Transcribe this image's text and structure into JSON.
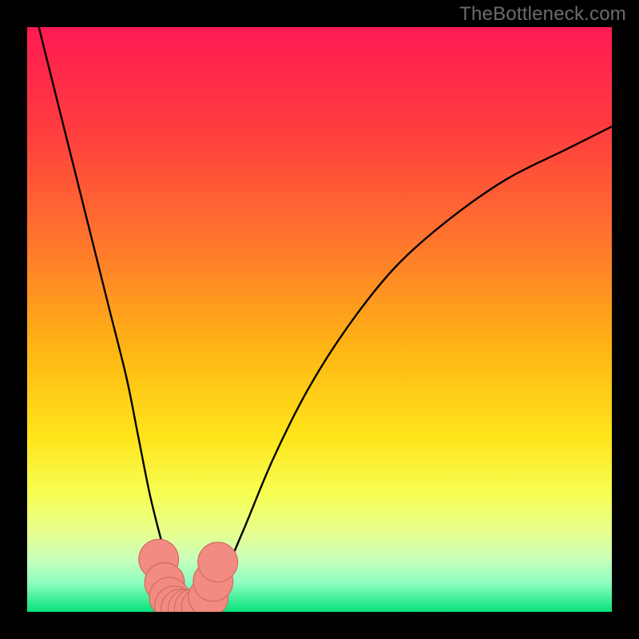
{
  "watermark": "TheBottleneck.com",
  "chart_data": {
    "type": "line",
    "title": "",
    "xlabel": "",
    "ylabel": "",
    "xlim": [
      0,
      100
    ],
    "ylim": [
      0,
      100
    ],
    "grid": false,
    "legend": false,
    "annotations": [],
    "background": {
      "type": "vertical-gradient",
      "stops": [
        {
          "pct": 0,
          "color": "#ff1a53"
        },
        {
          "pct": 18,
          "color": "#ff3e3e"
        },
        {
          "pct": 38,
          "color": "#ff7a2b"
        },
        {
          "pct": 55,
          "color": "#ffb514"
        },
        {
          "pct": 70,
          "color": "#ffe41b"
        },
        {
          "pct": 80,
          "color": "#f6ff54"
        },
        {
          "pct": 86,
          "color": "#eaff8c"
        },
        {
          "pct": 91,
          "color": "#c9ffba"
        },
        {
          "pct": 95,
          "color": "#8effc0"
        },
        {
          "pct": 100,
          "color": "#06e27a"
        }
      ]
    },
    "series": [
      {
        "name": "bottleneck-curve",
        "color": "#000000",
        "stroke_width": 2,
        "x": [
          2,
          5,
          8,
          11,
          14,
          17,
          19,
          21,
          23,
          25,
          26.5,
          28,
          30,
          33,
          37,
          42,
          48,
          55,
          63,
          72,
          82,
          92,
          100
        ],
        "y": [
          100,
          88,
          76,
          64,
          52,
          40,
          30,
          20,
          12,
          5,
          1,
          0.5,
          1,
          5,
          14,
          26,
          38,
          49,
          59,
          67,
          74,
          79,
          83
        ]
      }
    ],
    "markers": [
      {
        "name": "floor-markers",
        "color": "#f28b82",
        "stroke": "#d46a5f",
        "r": 3.4,
        "points": [
          {
            "x": 22.5,
            "y": 9
          },
          {
            "x": 23.5,
            "y": 5
          },
          {
            "x": 24.3,
            "y": 2.5
          },
          {
            "x": 25.2,
            "y": 1.0
          },
          {
            "x": 26.3,
            "y": 0.5
          },
          {
            "x": 27.5,
            "y": 0.5
          },
          {
            "x": 28.6,
            "y": 0.6
          },
          {
            "x": 29.8,
            "y": 0.8
          },
          {
            "x": 31.0,
            "y": 2.5
          },
          {
            "x": 31.8,
            "y": 5.2
          },
          {
            "x": 32.6,
            "y": 8.5
          }
        ]
      }
    ]
  }
}
